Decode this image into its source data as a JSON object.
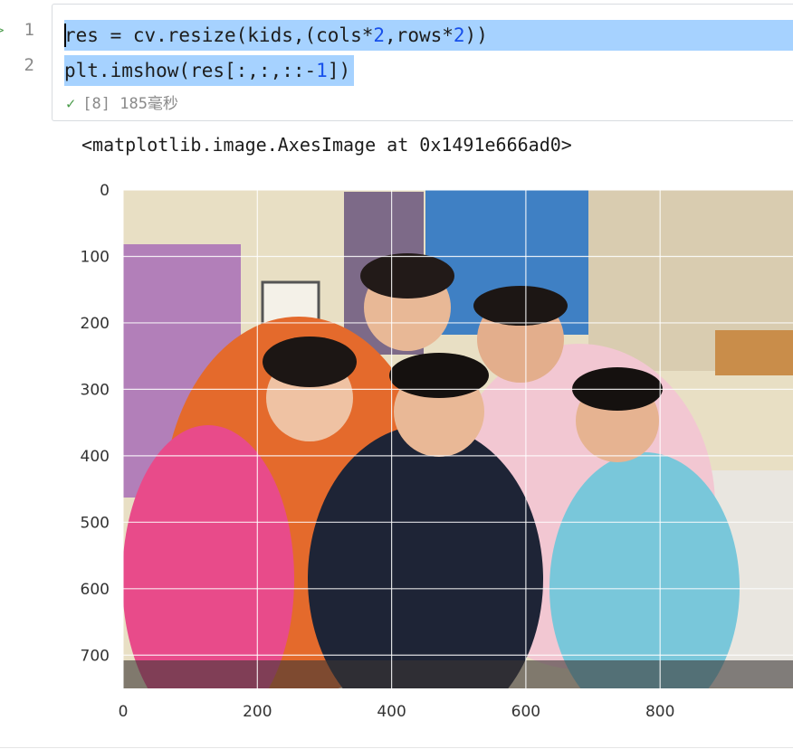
{
  "cell": {
    "line_numbers": [
      "1",
      "2"
    ],
    "code": {
      "line1": {
        "a": "res = cv.resize(kids,(cols*",
        "n1": "2",
        "b": ",rows*",
        "n2": "2",
        "c": "))"
      },
      "line2": {
        "a": "plt.imshow(res[:,:,::-",
        "n1": "1",
        "b": "])"
      }
    },
    "execution_count": "[8]",
    "duration": "185毫秒"
  },
  "output": {
    "repr": "<matplotlib.image.AxesImage at 0x1491e666ad0>"
  },
  "chart_data": {
    "type": "image",
    "x_ticks": [
      "0",
      "200",
      "400",
      "600",
      "800"
    ],
    "y_ticks": [
      "0",
      "100",
      "200",
      "300",
      "400",
      "500",
      "600",
      "700"
    ],
    "x_tick_values": [
      0,
      200,
      400,
      600,
      800
    ],
    "y_tick_values": [
      0,
      100,
      200,
      300,
      400,
      500,
      600,
      700
    ],
    "xlim": [
      0,
      998
    ],
    "ylim": [
      750,
      0
    ],
    "grid": true,
    "image_description_colors": {
      "wall": "#e8dfc4",
      "door": "#b27fb9",
      "shelf": "#3f80c4",
      "orange_shirt": "#e46a2c",
      "pink_shirt": "#e84b8a",
      "navy_shirt": "#1e2436",
      "pink_shirt_dad": "#f2c7d2",
      "cyan_shirt": "#79c7da",
      "sofa": "#e9e6e0"
    }
  }
}
